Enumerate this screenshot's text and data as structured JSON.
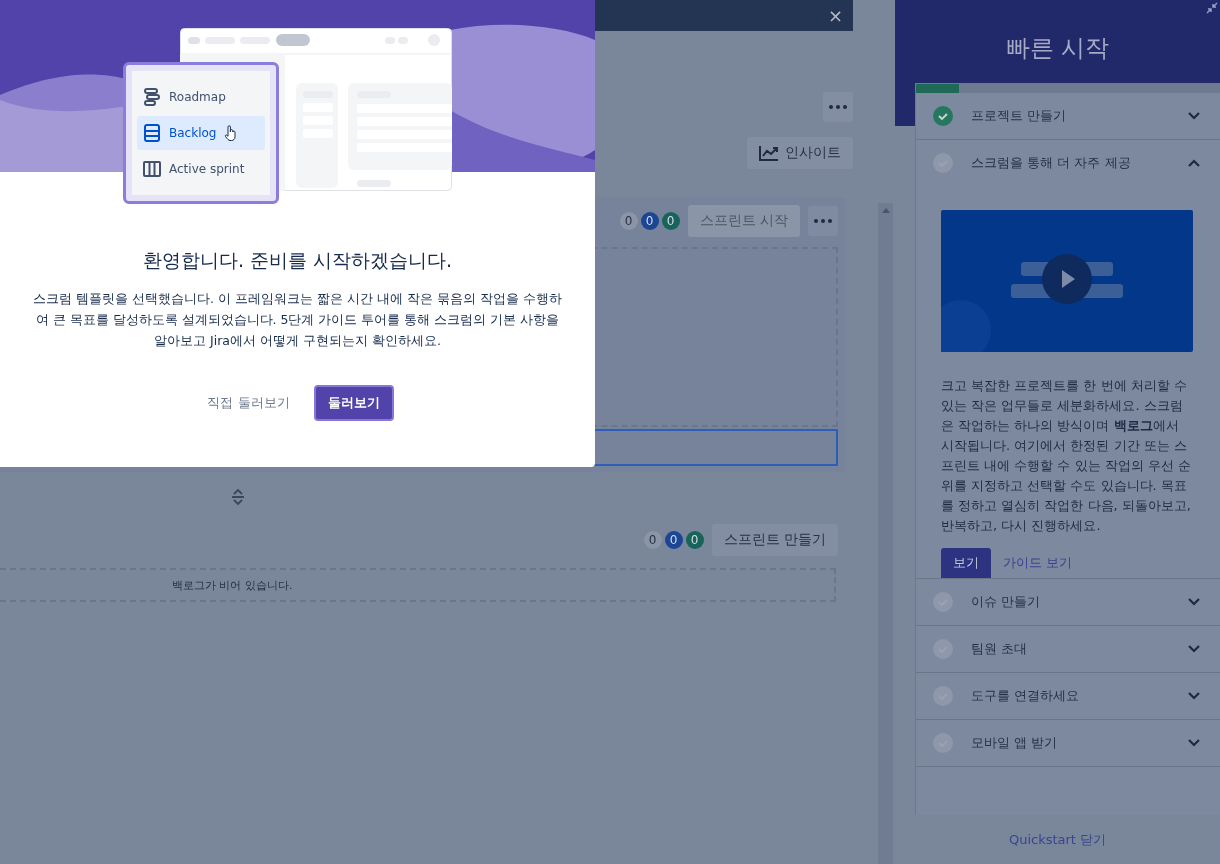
{
  "top_bar": {
    "close": "×"
  },
  "board": {
    "insights_button": "인사이트",
    "sprint": {
      "counts": [
        {
          "value": "0",
          "color": "#8c95a6"
        },
        {
          "value": "0",
          "color": "#1c4596"
        },
        {
          "value": "0",
          "color": "#17655a"
        }
      ],
      "start_button": {
        "label": "스프린트 시작",
        "disabled": true
      }
    },
    "backlog": {
      "counts": [
        {
          "value": "0",
          "color": "#8c95a6"
        },
        {
          "value": "0",
          "color": "#1c4596"
        },
        {
          "value": "0",
          "color": "#17655a"
        }
      ],
      "create_button": "스프린트 만들기",
      "empty_message": "백로그가 비어 있습니다."
    }
  },
  "welcome_modal": {
    "menu": [
      {
        "label": "Roadmap",
        "kind": "roadmap",
        "selected": false
      },
      {
        "label": "Backlog",
        "kind": "backlog",
        "selected": true
      },
      {
        "label": "Active sprint",
        "kind": "board",
        "selected": false
      }
    ],
    "title": "환영합니다. 준비를 시작하겠습니다.",
    "body": "스크럼 템플릿을 선택했습니다. 이 프레임워크는 짧은 시간 내에 작은 묶음의 작업을 수행하여 큰 목표를 달성하도록 설계되었습니다. 5단계 가이드 투어를 통해 스크럼의 기본 사항을 알아보고 Jira에서 어떻게 구현되는지 확인하세요.",
    "secondary_button": "직접 둘러보기",
    "primary_button": "둘러보기"
  },
  "quickstart": {
    "title": "빠른 시작",
    "level": 0.14,
    "steps": [
      {
        "label": "프로젝트 만들기",
        "done": true,
        "expanded": false
      },
      {
        "label": "스크럼을 통해 더 자주 제공",
        "done": false,
        "expanded": true,
        "description": "크고 복잡한 프로젝트를 한 번에 처리할 수 있는 작은 업무들로 세분화하세요. 스크럼은 작업하는 하나의 방식이며 **백로그**에서 시작됩니다. 여기에서 한정된 기간 또는 스프린트 내에 수행할 수 있는 작업의 우선 순위를 지정하고 선택할 수도 있습니다. 목표를 정하고 열심히 작업한 다음, 되돌아보고, 반복하고, 다시 진행하세요.",
        "watch_button": "보기",
        "guide_link": "가이드 보기"
      },
      {
        "label": "이슈 만들기",
        "done": false,
        "expanded": false
      },
      {
        "label": "팀원 초대",
        "done": false,
        "expanded": false
      },
      {
        "label": "도구를 연결하세요",
        "done": false,
        "expanded": false
      },
      {
        "label": "모바일 앱 받기",
        "done": false,
        "expanded": false
      }
    ],
    "close_link": "Quickstart 닫기"
  }
}
